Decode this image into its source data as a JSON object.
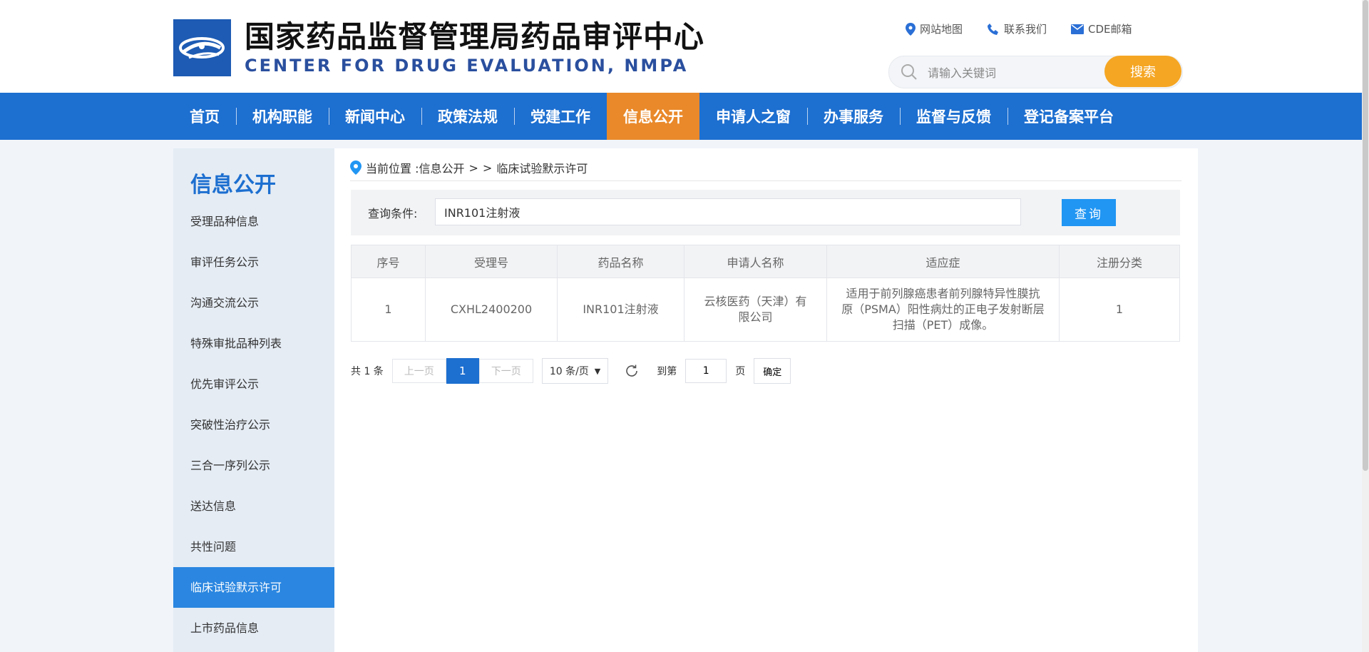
{
  "header": {
    "title_cn": "国家药品监督管理局药品审评中心",
    "title_en": "CENTER FOR DRUG EVALUATION, NMPA",
    "links": [
      {
        "label": "网站地图",
        "icon": "map-pin-icon"
      },
      {
        "label": "联系我们",
        "icon": "phone-icon"
      },
      {
        "label": "CDE邮箱",
        "icon": "mail-icon"
      }
    ],
    "search_placeholder": "请输入关键词",
    "search_button": "搜索"
  },
  "nav": [
    {
      "label": "首页"
    },
    {
      "label": "机构职能"
    },
    {
      "label": "新闻中心"
    },
    {
      "label": "政策法规"
    },
    {
      "label": "党建工作"
    },
    {
      "label": "信息公开",
      "active": true
    },
    {
      "label": "申请人之窗"
    },
    {
      "label": "办事服务"
    },
    {
      "label": "监督与反馈"
    },
    {
      "label": "登记备案平台"
    }
  ],
  "sidebar": {
    "title": "信息公开",
    "items": [
      {
        "label": "受理品种信息"
      },
      {
        "label": "审评任务公示"
      },
      {
        "label": "沟通交流公示"
      },
      {
        "label": "特殊审批品种列表"
      },
      {
        "label": "优先审评公示"
      },
      {
        "label": "突破性治疗公示"
      },
      {
        "label": "三合一序列公示"
      },
      {
        "label": "送达信息"
      },
      {
        "label": "共性问题"
      },
      {
        "label": "临床试验默示许可",
        "active": true
      },
      {
        "label": "上市药品信息"
      }
    ]
  },
  "breadcrumb": {
    "prefix": "当前位置 : ",
    "level1": "信息公开",
    "sep": ">",
    "sep2": ">",
    "current": "临床试验默示许可"
  },
  "query": {
    "label": "查询条件:",
    "value": "INR101注射液",
    "button": "查询"
  },
  "table": {
    "headers": [
      "序号",
      "受理号",
      "药品名称",
      "申请人名称",
      "适应症",
      "注册分类"
    ],
    "rows": [
      [
        "1",
        "CXHL2400200",
        "INR101注射液",
        "云核医药（天津）有限公司",
        "适用于前列腺癌患者前列腺特异性膜抗原（PSMA）阳性病灶的正电子发射断层扫描（PET）成像。",
        "1"
      ]
    ]
  },
  "pager": {
    "total": "共 1 条",
    "prev": "上一页",
    "current": "1",
    "next": "下一页",
    "page_size": "10 条/页",
    "goto_label": "到第",
    "goto_value": "1",
    "page_unit": "页",
    "confirm": "确定"
  },
  "colors": {
    "nav_bg": "#1d6fd0",
    "nav_active": "#e9892a",
    "search_btn": "#f5a623",
    "query_btn": "#2196f3",
    "sidebar_active": "#2a86e0"
  }
}
